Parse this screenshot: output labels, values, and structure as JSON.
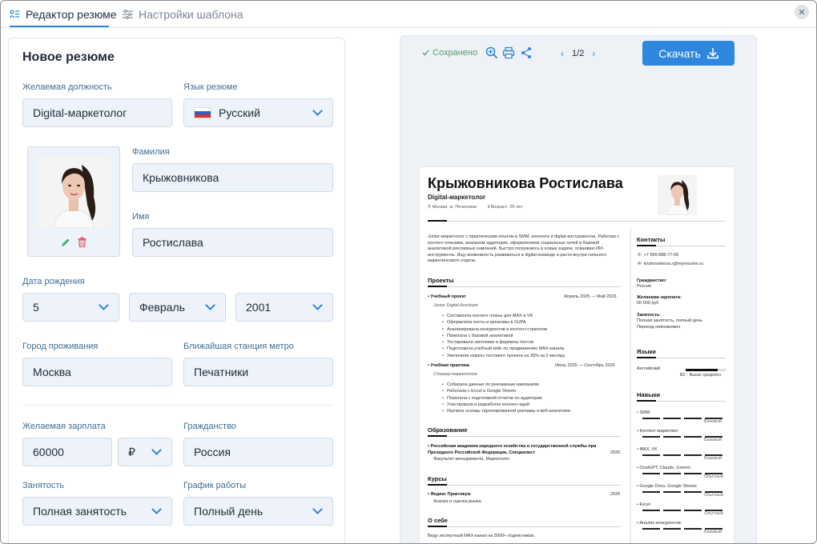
{
  "tabs": {
    "editor": "Редактор резюме",
    "template": "Настройки шаблона"
  },
  "form": {
    "title": "Новое резюме",
    "position": {
      "label": "Желаемая должность",
      "value": "Digital-маркетолог"
    },
    "language": {
      "label": "Язык резюме",
      "value": "Русский"
    },
    "surname": {
      "label": "Фамилия",
      "value": "Крыжовникова"
    },
    "name": {
      "label": "Имя",
      "value": "Ростислава"
    },
    "birth": {
      "label": "Дата рождения",
      "day": "5",
      "month": "Февраль",
      "year": "2001"
    },
    "city": {
      "label": "Город проживания",
      "value": "Москва"
    },
    "metro": {
      "label": "Ближайшая станция метро",
      "value": "Печатники"
    },
    "salary": {
      "label": "Желаемая зарплата",
      "value": "60000",
      "currency": "₽"
    },
    "citizenship": {
      "label": "Гражданство",
      "value": "Россия"
    },
    "employment": {
      "label": "Занятость",
      "value": "Полная занятость"
    },
    "schedule": {
      "label": "График работы",
      "value": "Полный день"
    }
  },
  "preview": {
    "saved": "Сохранено",
    "page": "1/2",
    "download": "Скачать"
  },
  "resume": {
    "name": "Крыжовникова Ростислава",
    "title": "Digital-маркетолог",
    "location": "Москва, м. Печатники",
    "age": "Возраст: 25 лет",
    "summary": "Junior-маркетолог с практическим опытом в SMM, контенте и digital-инструментах. Работаю с контент-планами, анализом аудитории, оформлением социальных сетей и базовой аналитикой рекламных кампаний. Быстро погружаюсь в новые задачи, осваиваю ИИ-инструменты. Ищу возможность развиваться в digital-команде и расти внутри сильного маркетингового отдела.",
    "projects_title": "Проекты",
    "projects": [
      {
        "name": "Учебный проект",
        "dates": "Апрель 2025 — Май 2026",
        "role": "Junior Digital Assistant",
        "items": [
          "Составляла контент планы для MAX и VK",
          "Оформляла посты и креативы в SUPA",
          "Анализировала конкурентов и контент-стратегии",
          "Помогала с базовой аналитикой",
          "Тестировала заголовки и форматы постов",
          "Подготовила учебный кейс по продвижению MAX-канала",
          "Увеличила охваты тестового проекта на 35% за 2 месяца"
        ]
      },
      {
        "name": "Учебная практика",
        "dates": "Июнь 2025 — Сентябрь 2025",
        "role": "Стажер-маркетолог",
        "items": [
          "Собирала данные по рекламным кампаниям",
          "Работала с Excel и Google Sheets",
          "Помогала с подготовкой отчетов по аудитории",
          "Участвовала в разработке контент-идей",
          "Изучила основы таргетированной рекламы и веб-аналитики"
        ]
      }
    ],
    "education_title": "Образование",
    "education": {
      "school": "Российская академия народного хозяйства и государственной службы при Президенте Российской Федерации, Специалист",
      "year": "2025",
      "faculty": "Факультет менеджмента, Маркетолог"
    },
    "courses_title": "Курсы",
    "course": {
      "name": "Яндекс Практикум",
      "year": "2026",
      "desc": "Анализ и оценка рынка"
    },
    "about_title": "О себе",
    "about": "Веду экспертный MAX-канал на 5000+ подписчиков.",
    "contacts_title": "Контакты",
    "phone": "+7 999 888-77-66",
    "email": "krizhovnikova.r@myresume.ru",
    "citizenship_label": "Гражданство:",
    "citizenship": "Россия",
    "salary_label": "Желаемая зарплата:",
    "salary": "60 000 руб",
    "employment_label": "Занятость:",
    "employment": "Полная занятость, полный день",
    "relocation": "Переезд невозможен",
    "languages_title": "Языки",
    "lang_name": "Английский",
    "lang_level": "B2 - Выше среднего",
    "skills_title": "Навыки",
    "skills": [
      {
        "name": "SMM",
        "level": "Базовый"
      },
      {
        "name": "Контент-маркетинг",
        "level": "Базовый"
      },
      {
        "name": "MAX, VK",
        "level": "Базовый"
      },
      {
        "name": "ChatGPT, Claude, Gemini",
        "level": "Опытный"
      },
      {
        "name": "Google Docs, Google Sheets",
        "level": "Опытный"
      },
      {
        "name": "Excel",
        "level": "Опытный"
      },
      {
        "name": "Анализ конкурентов",
        "level": "Базовый"
      }
    ]
  }
}
